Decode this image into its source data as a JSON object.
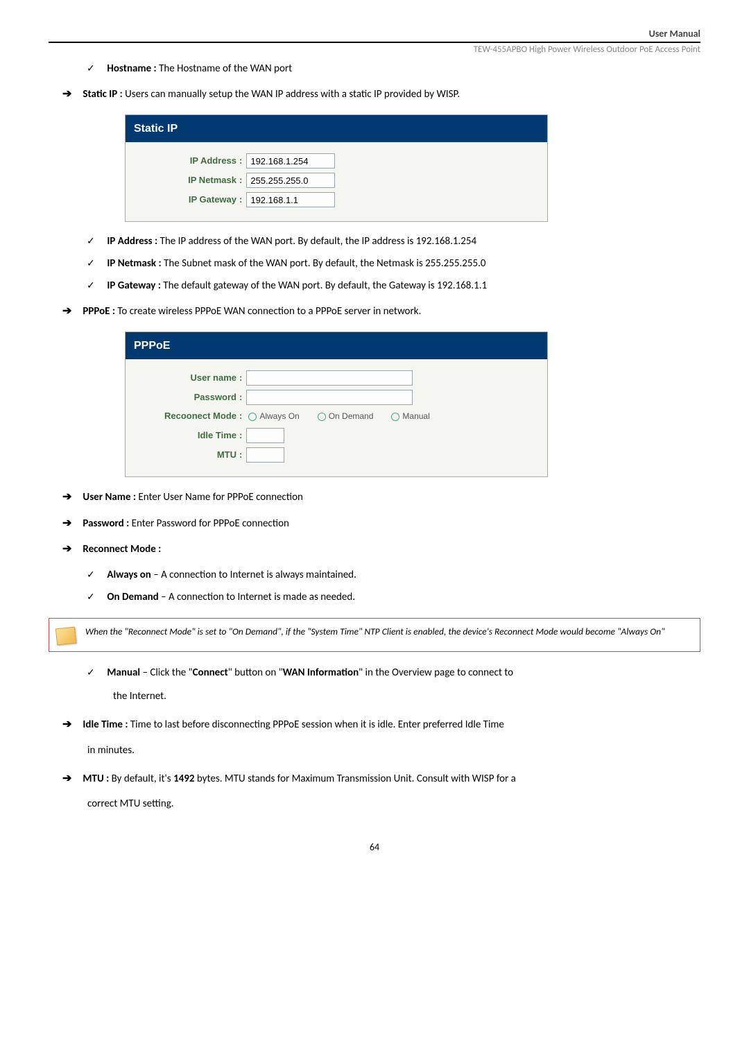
{
  "header": {
    "title": "User Manual",
    "subtitle": "TEW-455APBO High Power Wireless Outdoor PoE Access Point"
  },
  "line_hostname": {
    "label": "Hostname :",
    "text": " The Hostname of the WAN port"
  },
  "line_staticip": {
    "label": "Static IP :",
    "text": " Users can manually setup the WAN IP address with a static IP provided by WISP."
  },
  "panel_static": {
    "title": "Static IP",
    "rows": {
      "ip_address": {
        "label": "IP Address",
        "value": "192.168.1.254"
      },
      "ip_netmask": {
        "label": "IP Netmask",
        "value": "255.255.255.0"
      },
      "ip_gateway": {
        "label": "IP Gateway",
        "value": "192.168.1.1"
      }
    }
  },
  "static_notes": {
    "ip_address": {
      "label": "IP Address :",
      "text": " The IP address of the WAN port. By default, the IP address is 192.168.1.254"
    },
    "ip_netmask": {
      "label": "IP Netmask :",
      "text": " The Subnet mask of the WAN port. By default, the Netmask is 255.255.255.0"
    },
    "ip_gateway": {
      "label": "IP Gateway :",
      "text": " The default gateway of the WAN port. By default, the Gateway is 192.168.1.1"
    }
  },
  "line_pppoe": {
    "label": "PPPoE :",
    "text": " To create wireless PPPoE WAN connection to a PPPoE server in network."
  },
  "panel_pppoe": {
    "title": "PPPoE",
    "rows": {
      "username": {
        "label": "User name"
      },
      "password": {
        "label": "Password"
      },
      "reconnect": {
        "label": "Recoonect Mode",
        "opts": {
          "a": "Always On",
          "b": "On Demand",
          "c": "Manual"
        }
      },
      "idle": {
        "label": "Idle Time"
      },
      "mtu": {
        "label": "MTU"
      }
    }
  },
  "pppoe_notes": {
    "username": {
      "label": "User Name :",
      "text": " Enter User Name for PPPoE connection"
    },
    "password": {
      "label": "Password :",
      "text": " Enter Password for PPPoE connection"
    },
    "reconnect": {
      "label": "Reconnect Mode :"
    },
    "always_on": {
      "label": "Always on",
      "text": " – A connection to Internet is always maintained."
    },
    "on_demand": {
      "label": "On Demand",
      "text": " – A connection to Internet is made as needed."
    }
  },
  "note": {
    "text": "When the \"Reconnect Mode\" is set to \"On Demand\", if the \"System Time\" NTP Client is enabled, the device's Reconnect Mode would become \"Always On\""
  },
  "manual_line": {
    "label": "Manual",
    "p1": " – Click the \"",
    "b1": "Connect",
    "p2": "\" button on \"",
    "b2": "WAN Information",
    "p3": "\" in the Overview page to connect to",
    "p4": "the Internet."
  },
  "idle_line": {
    "label": "Idle Time :",
    "text": " Time to last before disconnecting PPPoE session when it is idle. Enter preferred Idle Time",
    "cont": "in minutes."
  },
  "mtu_line": {
    "label": "MTU :",
    "p1": " By default, it's ",
    "b1": "1492",
    "p2": " bytes. MTU stands for Maximum Transmission Unit. Consult with WISP for a",
    "cont": "correct MTU setting."
  },
  "page_number": "64"
}
